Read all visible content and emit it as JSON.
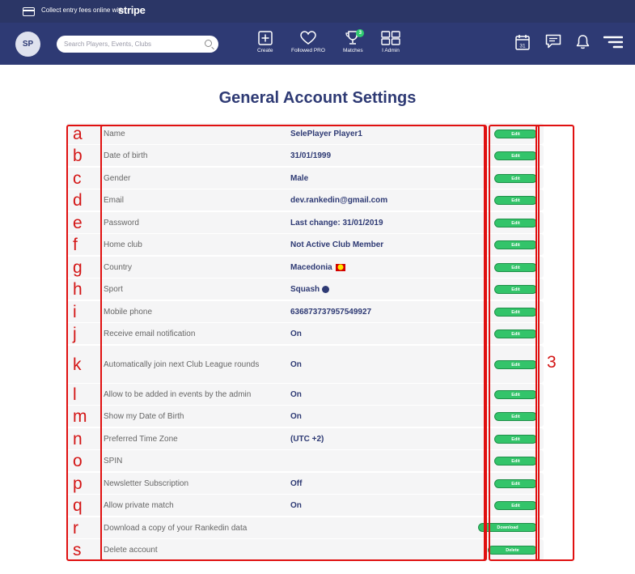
{
  "promo": {
    "text": "Collect entry fees online with",
    "brand": "stripe"
  },
  "header": {
    "avatar_initials": "SP",
    "search_placeholder": "Search Players, Events, Clubs",
    "nav": [
      {
        "label": "Create",
        "icon": "plus-square-icon"
      },
      {
        "label": "Followed PRO",
        "icon": "heart-icon"
      },
      {
        "label": "Matches",
        "icon": "trophy-icon",
        "badge": "3"
      },
      {
        "label": "I Admin",
        "icon": "grid-icon"
      }
    ],
    "right_icons": [
      "calendar-icon",
      "chat-icon",
      "bell-icon",
      "menu-icon"
    ],
    "calendar_day": "31"
  },
  "page": {
    "title": "General Account Settings"
  },
  "settings": [
    {
      "letter": "a",
      "label": "Name",
      "value": "SelePlayer Player1",
      "action": "Edit"
    },
    {
      "letter": "b",
      "label": "Date of birth",
      "value": "31/01/1999",
      "action": "Edit"
    },
    {
      "letter": "c",
      "label": "Gender",
      "value": "Male",
      "action": "Edit"
    },
    {
      "letter": "d",
      "label": "Email",
      "value": "dev.rankedin@gmail.com",
      "action": "Edit"
    },
    {
      "letter": "e",
      "label": "Password",
      "value": "Last change: 31/01/2019",
      "action": "Edit"
    },
    {
      "letter": "f",
      "label": "Home club",
      "value": "Not Active Club Member",
      "action": "Edit"
    },
    {
      "letter": "g",
      "label": "Country",
      "value": "Macedonia",
      "action": "Edit"
    },
    {
      "letter": "h",
      "label": "Sport",
      "value": "Squash",
      "action": "Edit"
    },
    {
      "letter": "i",
      "label": "Mobile phone",
      "value": "636873737957549927",
      "action": "Edit"
    },
    {
      "letter": "j",
      "label": "Receive email notification",
      "value": "On",
      "action": "Edit"
    },
    {
      "letter": "k",
      "label": "Automatically join next Club League rounds",
      "value": "On",
      "action": "Edit"
    },
    {
      "letter": "l",
      "label": "Allow to be added in events by the admin",
      "value": "On",
      "action": "Edit"
    },
    {
      "letter": "m",
      "label": "Show my Date of Birth",
      "value": "On",
      "action": "Edit"
    },
    {
      "letter": "n",
      "label": "Preferred Time Zone",
      "value": "(UTC +2)",
      "action": "Edit"
    },
    {
      "letter": "o",
      "label": "SPIN",
      "value": "",
      "action": "Edit"
    },
    {
      "letter": "p",
      "label": "Newsletter Subscription",
      "value": "Off",
      "action": "Edit"
    },
    {
      "letter": "q",
      "label": "Allow private match",
      "value": "On",
      "action": "Edit"
    },
    {
      "letter": "r",
      "label": "Download a copy of your Rankedin data",
      "value": "",
      "action": "Download"
    },
    {
      "letter": "s",
      "label": "Delete account",
      "value": "",
      "action": "Delete"
    }
  ],
  "annotation": {
    "column_number": "3"
  },
  "colors": {
    "navy": "#2e3a74",
    "green": "#33c46a",
    "annotation_red": "#e01010"
  }
}
